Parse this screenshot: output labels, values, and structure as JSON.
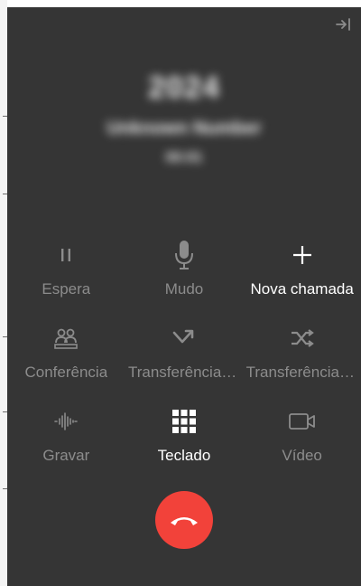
{
  "colors": {
    "panel_bg": "#353535",
    "disabled": "#8c8c8c",
    "active": "#ffffff",
    "hangup": "#f2423a"
  },
  "caller": {
    "line1": "2024",
    "line2": "Unknown Number",
    "line3": "00:01"
  },
  "controls": [
    {
      "id": "hold",
      "label": "Espera",
      "icon": "pause-icon",
      "state": "disabled"
    },
    {
      "id": "mute",
      "label": "Mudo",
      "icon": "microphone-icon",
      "state": "disabled"
    },
    {
      "id": "new-call",
      "label": "Nova chamada",
      "icon": "plus-icon",
      "state": "active"
    },
    {
      "id": "conference",
      "label": "Conferência",
      "icon": "conference-icon",
      "state": "disabled"
    },
    {
      "id": "transfer-direct",
      "label": "Transferência direta",
      "icon": "transfer-direct-icon",
      "state": "disabled"
    },
    {
      "id": "transfer-attended",
      "label": "Transferência assistida",
      "icon": "shuffle-icon",
      "state": "disabled"
    },
    {
      "id": "record",
      "label": "Gravar",
      "icon": "waveform-icon",
      "state": "disabled"
    },
    {
      "id": "keypad",
      "label": "Teclado",
      "icon": "keypad-icon",
      "state": "active"
    },
    {
      "id": "video",
      "label": "Vídeo",
      "icon": "video-camera-icon",
      "state": "disabled"
    }
  ],
  "hangup": {
    "icon": "phone-hangup-icon"
  },
  "header": {
    "icon": "exit-arrow-icon"
  }
}
